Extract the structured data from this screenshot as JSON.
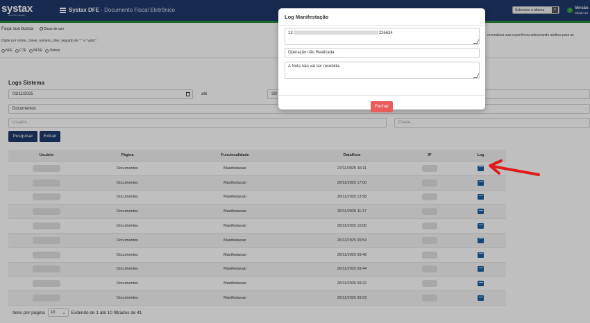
{
  "header": {
    "logo": "systax",
    "logo_sub": "SYSTAX company",
    "app_title": "Systax DFE",
    "app_subtitle": "- Documento Fiscal Eletrônico",
    "language_select": "Selecione o idioma",
    "version_label": "Versão",
    "version_sub": "Clique ao"
  },
  "search": {
    "title": "Faça sua busca",
    "tips": "Dicas de uso",
    "hint": "Digite por nome, chave, numero_nfse, seguido de \":\" e \"valor\".",
    "hint_right": "ersonalizar sua experiência adicionando atalhos para as",
    "doc_types": [
      "NFE",
      "CTE",
      "NFSE",
      "Outros"
    ]
  },
  "logs": {
    "title": "Logs Sistema",
    "date_from": "01/11/2025",
    "until_label": "até",
    "date_to": "30/",
    "document_type": "Documentos",
    "user_placeholder": "Usuário...",
    "key_placeholder": "Chave...",
    "search_button": "Pesquisar",
    "export_button": "Extrair"
  },
  "table": {
    "columns": [
      "Usuário",
      "Página",
      "Funcionalidade",
      "DataHora",
      "IP",
      "Log"
    ],
    "rows": [
      {
        "pagina": "Documentos",
        "funcionalidade": "Manifestacao",
        "datahora": "27/11/2025 16:11"
      },
      {
        "pagina": "Documentos",
        "funcionalidade": "Manifestacao",
        "datahora": "26/11/2025 17:00"
      },
      {
        "pagina": "Documentos",
        "funcionalidade": "Manifestacao",
        "datahora": "26/11/2025 13:58"
      },
      {
        "pagina": "Documentos",
        "funcionalidade": "Manifestacao",
        "datahora": "26/11/2025 11:17"
      },
      {
        "pagina": "Documentos",
        "funcionalidade": "Manifestacao",
        "datahora": "26/11/2025 10:00"
      },
      {
        "pagina": "Documentos",
        "funcionalidade": "Manifestacao",
        "datahora": "26/11/2025 09:54"
      },
      {
        "pagina": "Documentos",
        "funcionalidade": "Manifestacao",
        "datahora": "26/11/2025 09:48"
      },
      {
        "pagina": "Documentos",
        "funcionalidade": "Manifestacao",
        "datahora": "26/11/2025 09:44"
      },
      {
        "pagina": "Documentos",
        "funcionalidade": "Manifestacao",
        "datahora": "26/11/2025 09:22"
      },
      {
        "pagina": "Documentos",
        "funcionalidade": "Manifestacao",
        "datahora": "26/11/2025 09:03"
      }
    ]
  },
  "pager": {
    "label": "Itens por página",
    "page_size": "10",
    "summary": "Exibindo de 1 até 10 filtrados de 41"
  },
  "modal": {
    "title": "Log Manifestação",
    "key_prefix": "13",
    "key_suffix": "226634",
    "status": "Operação não Realizada",
    "message": "A Nota não vai ser recebida.",
    "close_button": "Fechar"
  },
  "colors": {
    "header": "#1f3a6b",
    "accent_green": "#2e8b3c",
    "close_button": "#e85c5c",
    "annotation_arrow": "#e01b1b"
  }
}
